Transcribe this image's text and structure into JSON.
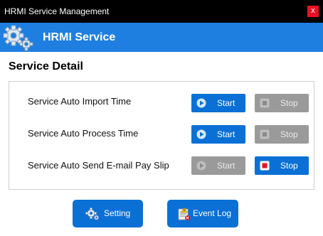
{
  "window": {
    "title": "HRMI Service Management",
    "close_label": "x"
  },
  "header": {
    "title": "HRMI Service",
    "icon": "gears-icon"
  },
  "section": {
    "title": "Service Detail"
  },
  "services": [
    {
      "label": "Service Auto Import Time",
      "start_label": "Start",
      "stop_label": "Stop",
      "start_enabled": true,
      "stop_enabled": false
    },
    {
      "label": "Service Auto Process Time",
      "start_label": "Start",
      "stop_label": "Stop",
      "start_enabled": true,
      "stop_enabled": false
    },
    {
      "label": "Service Auto Send E-mail Pay Slip",
      "start_label": "Start",
      "stop_label": "Stop",
      "start_enabled": false,
      "stop_enabled": true
    }
  ],
  "footer": {
    "setting_label": "Setting",
    "event_log_label": "Event Log"
  },
  "colors": {
    "accent": "#0a70d6",
    "banner": "#1e7fe0",
    "disabled": "#9a9a9a",
    "stop_active": "#e81123"
  }
}
